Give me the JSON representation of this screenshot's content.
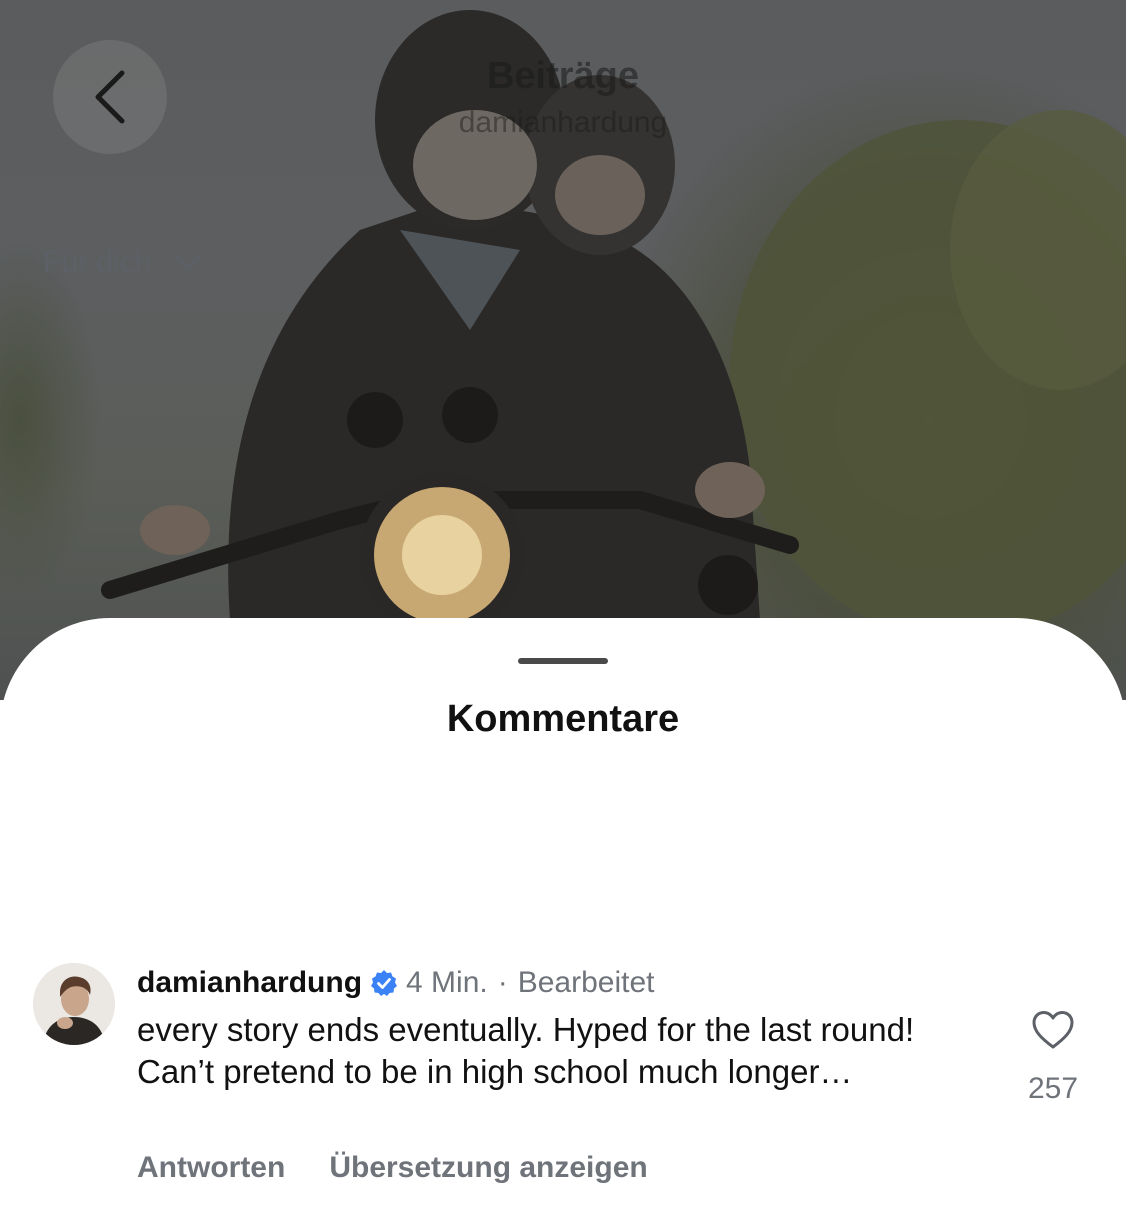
{
  "header": {
    "title": "Beiträge",
    "username": "damianhardung"
  },
  "sheet": {
    "title": "Kommentare",
    "sort_label": "Für dich"
  },
  "comment": {
    "username": "damianhardung",
    "verified": true,
    "time": "4 Min.",
    "separator": "·",
    "edited": "Bearbeitet",
    "text": "every story ends eventually. Hyped for the last round! Can’t pretend to be in high school much longer…",
    "like_count": "257",
    "reply_label": "Antworten",
    "translate_label": "Übersetzung anzeigen"
  },
  "colors": {
    "verified_badge": "#3b82f6",
    "secondary_text": "#6f737a"
  },
  "icons": [
    "chevron-left-icon",
    "chevron-down-icon",
    "verified-badge-icon",
    "heart-icon"
  ]
}
